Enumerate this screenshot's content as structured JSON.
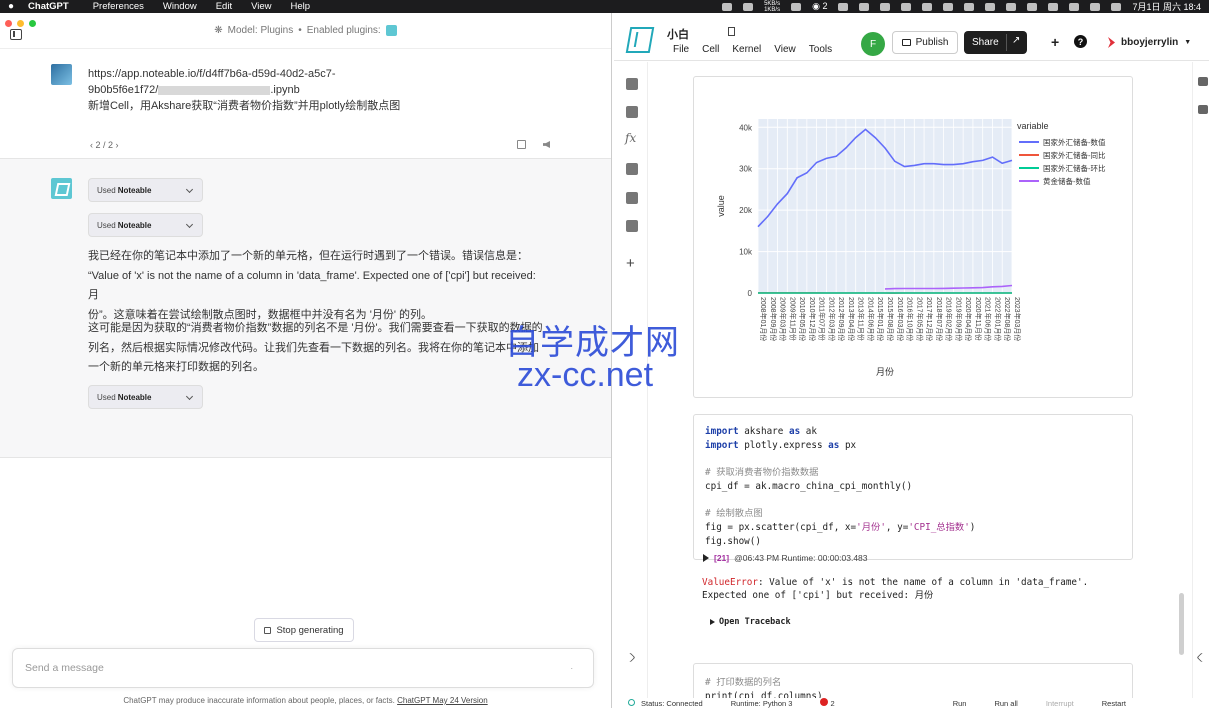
{
  "menubar": {
    "app": "ChatGPT",
    "items": [
      "Preferences",
      "Window",
      "Edit",
      "View",
      "Help"
    ],
    "netspeed_up": "5KB/s",
    "netspeed_down": "1KB/s",
    "wechat_count": "2",
    "clock": "7月1日 周六 18:4"
  },
  "chat": {
    "model_label": "Model: Plugins",
    "separator": "•",
    "plugins_label": "Enabled plugins:",
    "user_message": {
      "line1": "https://app.noteable.io/f/d4ff7b6a-d59d-40d2-a5c7-",
      "line2_prefix": "9b0b5f6e1f72/",
      "line2_suffix": ".ipynb",
      "line3": "新增Cell，用Akshare获取“消费者物价指数”并用plotly绘制散点图"
    },
    "pager": "‹ 2 / 2 ›",
    "used_pills": [
      {
        "prefix": "Used",
        "name": "Noteable"
      },
      {
        "prefix": "Used",
        "name": "Noteable"
      },
      {
        "prefix": "Used",
        "name": "Noteable"
      }
    ],
    "para1": [
      "我已经在你的笔记本中添加了一个新的单元格，但在运行时遇到了一个错误。错误信息是：",
      "“Value of 'x' is not the name of a column in 'data_frame'. Expected one of ['cpi'] but received: 月",
      "份”。这意味着在尝试绘制散点图时，数据框中并没有名为 '月份' 的列。"
    ],
    "para2": [
      "这可能是因为获取的“消费者物价指数”数据的列名不是 '月份'。我们需要查看一下获取的数据的",
      "列名，然后根据实际情况修改代码。让我们先查看一下数据的列名。我将在你的笔记本中添加",
      "一个新的单元格来打印数据的列名。"
    ],
    "stop_label": "Stop generating",
    "send_placeholder": "Send a message",
    "footer_text": "ChatGPT may produce inaccurate information about people, places, or facts.",
    "footer_link": "ChatGPT May 24 Version"
  },
  "notebook": {
    "title": "小白",
    "menu": [
      "File",
      "Cell",
      "Kernel",
      "View",
      "Tools"
    ],
    "avatar_initial": "F",
    "publish_label": "Publish",
    "share_label": "Share",
    "username": "bboyjerrylin",
    "code_lines": [
      [
        {
          "t": "import",
          "c": "kw"
        },
        {
          "t": " akshare "
        },
        {
          "t": "as",
          "c": "kw"
        },
        {
          "t": " ak"
        }
      ],
      [
        {
          "t": "import",
          "c": "kw"
        },
        {
          "t": " plotly.express "
        },
        {
          "t": "as",
          "c": "kw"
        },
        {
          "t": " px"
        }
      ],
      [
        {
          "t": ""
        }
      ],
      [
        {
          "t": "# 获取消费者物价指数数据",
          "c": "cm"
        }
      ],
      [
        {
          "t": "cpi_df = ak.macro_china_cpi_monthly()"
        }
      ],
      [
        {
          "t": ""
        }
      ],
      [
        {
          "t": "# 绘制散点图",
          "c": "cm"
        }
      ],
      [
        {
          "t": "fig = px.scatter(cpi_df, x="
        },
        {
          "t": "'月份'",
          "c": "str"
        },
        {
          "t": ", y="
        },
        {
          "t": "'CPI_总指数'",
          "c": "str"
        },
        {
          "t": ")"
        }
      ],
      [
        {
          "t": "fig.show()"
        }
      ]
    ],
    "run_num": "[21]",
    "run_info": "@06:43 PM Runtime: 00:00:03.483",
    "error_type": "ValueError",
    "error_line1": ": Value of 'x' is not the name of a column in 'data_frame'.",
    "error_line2": "Expected one of ['cpi'] but received: 月份",
    "traceback_label": "Open Traceback",
    "next_cell_comment": "# 打印数据的列名",
    "next_cell_code": "print(cpi_df.columns)",
    "status": {
      "connection": "Status: Connected",
      "runtime": "Runtime: Python 3",
      "errors": "2",
      "run": "Run",
      "run_all": "Run all",
      "interrupt": "Interrupt",
      "restart": "Restart"
    }
  },
  "watermark": {
    "line1": "自学成才网",
    "line2": "zx-cc.net"
  },
  "chart_data": {
    "type": "line",
    "xlabel": "月份",
    "ylabel": "value",
    "legend_title": "variable",
    "legend_position": "right",
    "y_ticks": [
      "0",
      "10k",
      "20k",
      "30k",
      "40k"
    ],
    "ylim": [
      0,
      42000
    ],
    "x_tick_labels": [
      "2008年01月份",
      "2008年09月份",
      "2009年03月份",
      "2009年11月份",
      "2010年05月份",
      "2010年12月份",
      "2011年07月份",
      "2012年03月份",
      "2012年09月份",
      "2013年04月份",
      "2013年11月份",
      "2014年06月份",
      "2015年01月份",
      "2015年08月份",
      "2016年03月份",
      "2016年10月份",
      "2017年05月份",
      "2017年12月份",
      "2018年07月份",
      "2019年02月份",
      "2019年09月份",
      "2020年04月份",
      "2020年11月份",
      "2021年06月份",
      "2022年01月份",
      "2022年08月份",
      "2023年03月份"
    ],
    "series": [
      {
        "name": "国家外汇储备-数值",
        "color": "#636efa",
        "values": [
          16000,
          18500,
          21500,
          24000,
          27800,
          29000,
          31500,
          32500,
          33000,
          35000,
          37500,
          39500,
          37500,
          35000,
          31800,
          30500,
          30800,
          31200,
          31200,
          31000,
          31000,
          31200,
          31700,
          32000,
          32800,
          31300,
          32000
        ]
      },
      {
        "name": "国家外汇储备-同比",
        "color": "#ef553b",
        "values": [
          20,
          20,
          18,
          15,
          15,
          18,
          20,
          12,
          8,
          10,
          12,
          10,
          0,
          -10,
          -15,
          -12,
          -5,
          5,
          3,
          0,
          1,
          2,
          4,
          5,
          3,
          -5,
          1
        ]
      },
      {
        "name": "国家外汇储备-环比",
        "color": "#00cc96",
        "values": [
          1,
          1,
          1,
          2,
          1,
          1,
          1,
          0,
          0,
          1,
          1,
          1,
          0,
          -1,
          -1,
          -1,
          0,
          1,
          0,
          0,
          0,
          0,
          1,
          0,
          0,
          -1,
          0
        ]
      },
      {
        "name": "黄金储备-数值",
        "color": "#ab63fa",
        "values": [
          null,
          null,
          null,
          null,
          null,
          null,
          null,
          null,
          null,
          null,
          null,
          null,
          null,
          1000,
          1070,
          1080,
          1080,
          1080,
          1080,
          1100,
          1150,
          1200,
          1250,
          1300,
          1500,
          1600,
          1800
        ]
      }
    ]
  }
}
